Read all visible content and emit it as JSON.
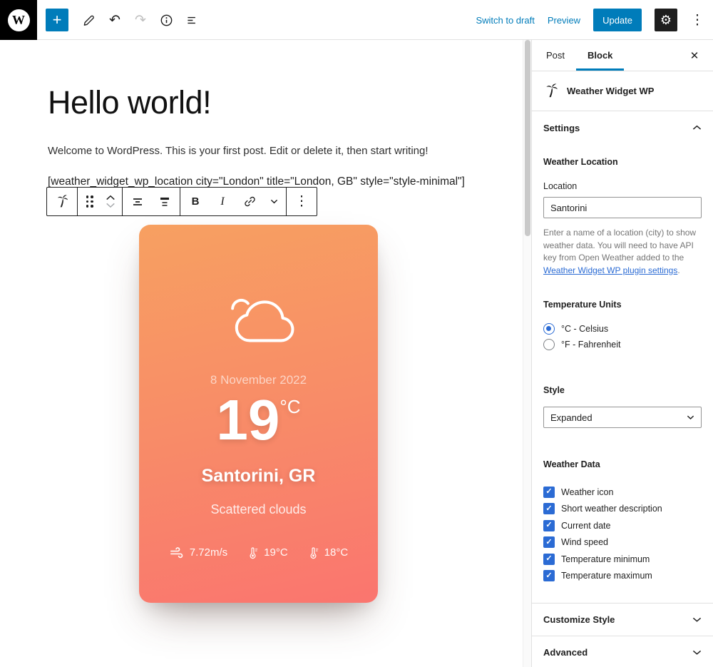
{
  "colors": {
    "accent": "#007cba",
    "control_blue": "#2b6bd4",
    "card_gradient_start": "#f7a061",
    "card_gradient_end": "#fa756f",
    "text_dark": "#1e1e1e",
    "text_muted": "#757575"
  },
  "icons": {
    "wp": "W",
    "plus": "+",
    "undo": "↶",
    "redo": "↷",
    "gear": "⚙",
    "kebab": "⋮",
    "close": "✕",
    "bold": "B",
    "italic": "I",
    "check": "✓"
  },
  "header": {
    "switch_to_draft": "Switch to draft",
    "preview": "Preview",
    "update": "Update"
  },
  "document": {
    "title": "Hello world!",
    "intro": "Welcome to WordPress. This is your first post. Edit or delete it, then start writing!",
    "shortcode": "[weather_widget_wp_location city=\"London\" title=\"London, GB\" style=\"style-minimal\"]"
  },
  "widget": {
    "date": "8 November 2022",
    "temperature": "19",
    "unit": "°C",
    "location": "Santorini, GR",
    "description": "Scattered clouds",
    "wind_speed": "7.72m/s",
    "temp_min": "19°C",
    "temp_max": "18°C"
  },
  "sidebar": {
    "tabs": {
      "post": "Post",
      "block": "Block"
    },
    "block_name": "Weather Widget WP",
    "settings_title": "Settings",
    "location_section": {
      "title": "Weather Location",
      "label": "Location",
      "value": "Santorini",
      "help_before": "Enter a name of a location (city) to show weather data. You will need to have API key from Open Weather added to the ",
      "help_link": "Weather Widget WP plugin settings",
      "help_after": "."
    },
    "units_section": {
      "title": "Temperature Units",
      "options": [
        {
          "label": "°C - Celsius",
          "checked": true
        },
        {
          "label": "°F - Fahrenheit",
          "checked": false
        }
      ]
    },
    "style_section": {
      "title": "Style",
      "value": "Expanded"
    },
    "data_section": {
      "title": "Weather Data",
      "options": [
        {
          "label": "Weather icon",
          "checked": true
        },
        {
          "label": "Short weather description",
          "checked": true
        },
        {
          "label": "Current date",
          "checked": true
        },
        {
          "label": "Wind speed",
          "checked": true
        },
        {
          "label": "Temperature minimum",
          "checked": true
        },
        {
          "label": "Temperature maximum",
          "checked": true
        }
      ]
    },
    "customize_style_title": "Customize Style",
    "advanced_title": "Advanced"
  }
}
